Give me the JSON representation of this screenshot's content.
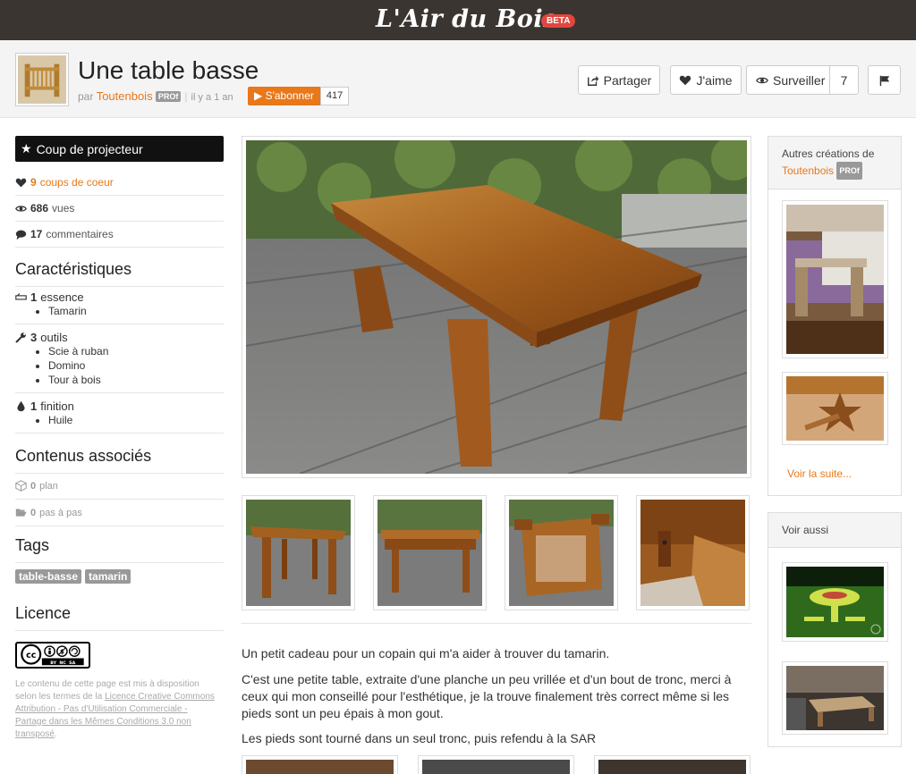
{
  "site": {
    "logo": "L'Air du Bois",
    "badge": "BETA"
  },
  "header": {
    "title": "Une table basse",
    "by_prefix": "par",
    "author": "Toutenbois",
    "author_badge": "PROf",
    "separator": "|",
    "time_ago": "il y a 1 an",
    "subscribe_label": "S'abonner",
    "subscribe_count": "417",
    "share_label": "Partager",
    "like_label": "J'aime",
    "watch_label": "Surveiller",
    "watch_count": "7"
  },
  "sidebar": {
    "spotlight_label": "Coup de projecteur",
    "stats": {
      "likes_count": "9",
      "likes_label": "coups de coeur",
      "views_count": "686",
      "views_label": "vues",
      "comments_count": "17",
      "comments_label": "commentaires"
    },
    "characteristics_title": "Caractéristiques",
    "features": [
      {
        "count": "1",
        "label": "essence",
        "items": [
          "Tamarin"
        ]
      },
      {
        "count": "3",
        "label": "outils",
        "items": [
          "Scie à ruban",
          "Domino",
          "Tour à bois"
        ]
      },
      {
        "count": "1",
        "label": "finition",
        "items": [
          "Huile"
        ]
      }
    ],
    "associated_title": "Contenus associés",
    "plans_count": "0",
    "plans_label": "plan",
    "steps_count": "0",
    "steps_label": "pas à pas",
    "tags_title": "Tags",
    "tags": [
      "table-basse",
      "tamarin"
    ],
    "license_title": "Licence",
    "license_badge": {
      "cc": "cc",
      "codes": "BY  NC  SA"
    },
    "license_text_before": "Le contenu de cette page est mis à disposition selon les termes de la",
    "license_link": "Licence Creative Commons Attribution - Pas d'Utilisation Commerciale - Partage dans les Mêmes Conditions 3.0 non transposé",
    "license_text_after": "."
  },
  "main": {
    "paragraphs": [
      "Un petit cadeau pour un copain qui m'a aider à trouver du tamarin.",
      "C'est une petite table, extraite d'une planche un peu vrillée et d'un bout de tronc, merci à ceux qui mon conseillé pour l'esthétique, je la trouve finalement très correct même si les pieds sont un peu épais à mon gout.",
      "Les pieds sont tourné dans un seul tronc, puis refendu à la SAR"
    ]
  },
  "right": {
    "other_title": "Autres créations de",
    "other_author": "Toutenbois",
    "other_badge": "PROf",
    "more_label": "Voir la suite...",
    "see_also_title": "Voir aussi"
  },
  "colors": {
    "accent": "#e8781a",
    "topbar": "#3a3531",
    "badge": "#e0473f"
  }
}
